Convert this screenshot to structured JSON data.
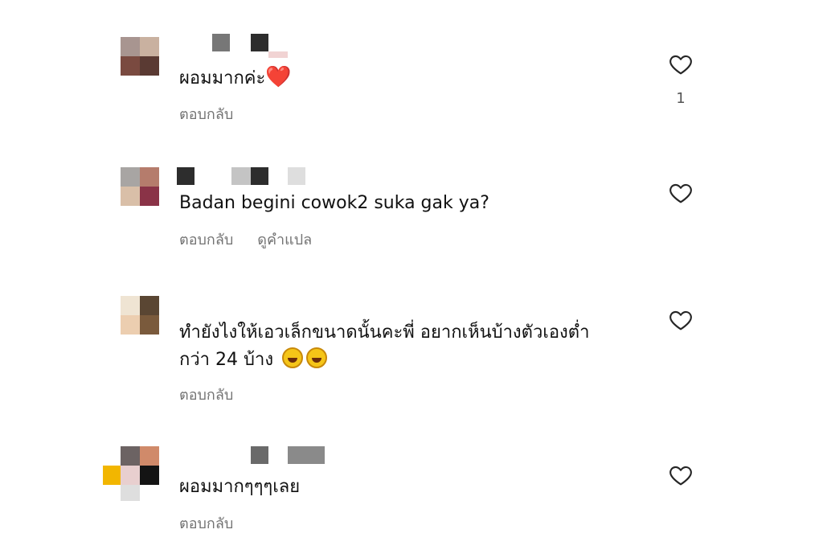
{
  "comments": [
    {
      "text": "ผอมมากค่ะ",
      "emoji": "❤️",
      "emoji_type": "red-heart",
      "actions": [
        "ตอบกลับ"
      ],
      "likes": "1"
    },
    {
      "text": "Badan begini cowok2 suka gak ya?",
      "actions": [
        "ตอบกลับ",
        "ดูคำแปล"
      ],
      "likes": ""
    },
    {
      "text": "ทำยังไงให้เอวเล็กขนาดนั้นคะพี่ อยากเห็นบ้างตัวเองต่ำ\nกว่า 24 บ้าง",
      "emoji_type": "rolling-on-floor-laughing",
      "emoji_count": 2,
      "actions": [
        "ตอบกลับ"
      ],
      "likes": ""
    },
    {
      "text": "ผอมมากๆๆๆเลย",
      "actions": [
        "ตอบกลับ"
      ],
      "likes": ""
    }
  ],
  "colors": {
    "secondary_text": "#737373",
    "heart_outline": "#262626"
  }
}
